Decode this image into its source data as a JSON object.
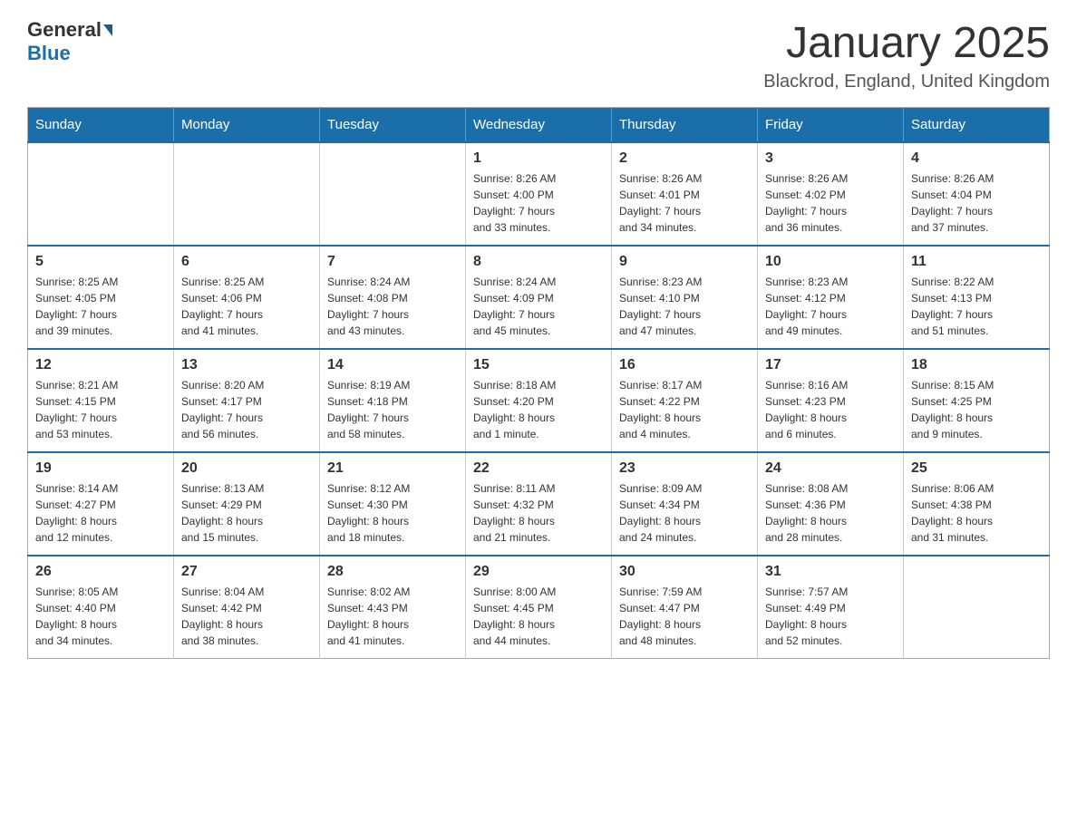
{
  "logo": {
    "general": "General",
    "blue": "Blue"
  },
  "title": "January 2025",
  "location": "Blackrod, England, United Kingdom",
  "days_of_week": [
    "Sunday",
    "Monday",
    "Tuesday",
    "Wednesday",
    "Thursday",
    "Friday",
    "Saturday"
  ],
  "weeks": [
    [
      {
        "day": "",
        "info": ""
      },
      {
        "day": "",
        "info": ""
      },
      {
        "day": "",
        "info": ""
      },
      {
        "day": "1",
        "info": "Sunrise: 8:26 AM\nSunset: 4:00 PM\nDaylight: 7 hours\nand 33 minutes."
      },
      {
        "day": "2",
        "info": "Sunrise: 8:26 AM\nSunset: 4:01 PM\nDaylight: 7 hours\nand 34 minutes."
      },
      {
        "day": "3",
        "info": "Sunrise: 8:26 AM\nSunset: 4:02 PM\nDaylight: 7 hours\nand 36 minutes."
      },
      {
        "day": "4",
        "info": "Sunrise: 8:26 AM\nSunset: 4:04 PM\nDaylight: 7 hours\nand 37 minutes."
      }
    ],
    [
      {
        "day": "5",
        "info": "Sunrise: 8:25 AM\nSunset: 4:05 PM\nDaylight: 7 hours\nand 39 minutes."
      },
      {
        "day": "6",
        "info": "Sunrise: 8:25 AM\nSunset: 4:06 PM\nDaylight: 7 hours\nand 41 minutes."
      },
      {
        "day": "7",
        "info": "Sunrise: 8:24 AM\nSunset: 4:08 PM\nDaylight: 7 hours\nand 43 minutes."
      },
      {
        "day": "8",
        "info": "Sunrise: 8:24 AM\nSunset: 4:09 PM\nDaylight: 7 hours\nand 45 minutes."
      },
      {
        "day": "9",
        "info": "Sunrise: 8:23 AM\nSunset: 4:10 PM\nDaylight: 7 hours\nand 47 minutes."
      },
      {
        "day": "10",
        "info": "Sunrise: 8:23 AM\nSunset: 4:12 PM\nDaylight: 7 hours\nand 49 minutes."
      },
      {
        "day": "11",
        "info": "Sunrise: 8:22 AM\nSunset: 4:13 PM\nDaylight: 7 hours\nand 51 minutes."
      }
    ],
    [
      {
        "day": "12",
        "info": "Sunrise: 8:21 AM\nSunset: 4:15 PM\nDaylight: 7 hours\nand 53 minutes."
      },
      {
        "day": "13",
        "info": "Sunrise: 8:20 AM\nSunset: 4:17 PM\nDaylight: 7 hours\nand 56 minutes."
      },
      {
        "day": "14",
        "info": "Sunrise: 8:19 AM\nSunset: 4:18 PM\nDaylight: 7 hours\nand 58 minutes."
      },
      {
        "day": "15",
        "info": "Sunrise: 8:18 AM\nSunset: 4:20 PM\nDaylight: 8 hours\nand 1 minute."
      },
      {
        "day": "16",
        "info": "Sunrise: 8:17 AM\nSunset: 4:22 PM\nDaylight: 8 hours\nand 4 minutes."
      },
      {
        "day": "17",
        "info": "Sunrise: 8:16 AM\nSunset: 4:23 PM\nDaylight: 8 hours\nand 6 minutes."
      },
      {
        "day": "18",
        "info": "Sunrise: 8:15 AM\nSunset: 4:25 PM\nDaylight: 8 hours\nand 9 minutes."
      }
    ],
    [
      {
        "day": "19",
        "info": "Sunrise: 8:14 AM\nSunset: 4:27 PM\nDaylight: 8 hours\nand 12 minutes."
      },
      {
        "day": "20",
        "info": "Sunrise: 8:13 AM\nSunset: 4:29 PM\nDaylight: 8 hours\nand 15 minutes."
      },
      {
        "day": "21",
        "info": "Sunrise: 8:12 AM\nSunset: 4:30 PM\nDaylight: 8 hours\nand 18 minutes."
      },
      {
        "day": "22",
        "info": "Sunrise: 8:11 AM\nSunset: 4:32 PM\nDaylight: 8 hours\nand 21 minutes."
      },
      {
        "day": "23",
        "info": "Sunrise: 8:09 AM\nSunset: 4:34 PM\nDaylight: 8 hours\nand 24 minutes."
      },
      {
        "day": "24",
        "info": "Sunrise: 8:08 AM\nSunset: 4:36 PM\nDaylight: 8 hours\nand 28 minutes."
      },
      {
        "day": "25",
        "info": "Sunrise: 8:06 AM\nSunset: 4:38 PM\nDaylight: 8 hours\nand 31 minutes."
      }
    ],
    [
      {
        "day": "26",
        "info": "Sunrise: 8:05 AM\nSunset: 4:40 PM\nDaylight: 8 hours\nand 34 minutes."
      },
      {
        "day": "27",
        "info": "Sunrise: 8:04 AM\nSunset: 4:42 PM\nDaylight: 8 hours\nand 38 minutes."
      },
      {
        "day": "28",
        "info": "Sunrise: 8:02 AM\nSunset: 4:43 PM\nDaylight: 8 hours\nand 41 minutes."
      },
      {
        "day": "29",
        "info": "Sunrise: 8:00 AM\nSunset: 4:45 PM\nDaylight: 8 hours\nand 44 minutes."
      },
      {
        "day": "30",
        "info": "Sunrise: 7:59 AM\nSunset: 4:47 PM\nDaylight: 8 hours\nand 48 minutes."
      },
      {
        "day": "31",
        "info": "Sunrise: 7:57 AM\nSunset: 4:49 PM\nDaylight: 8 hours\nand 52 minutes."
      },
      {
        "day": "",
        "info": ""
      }
    ]
  ]
}
